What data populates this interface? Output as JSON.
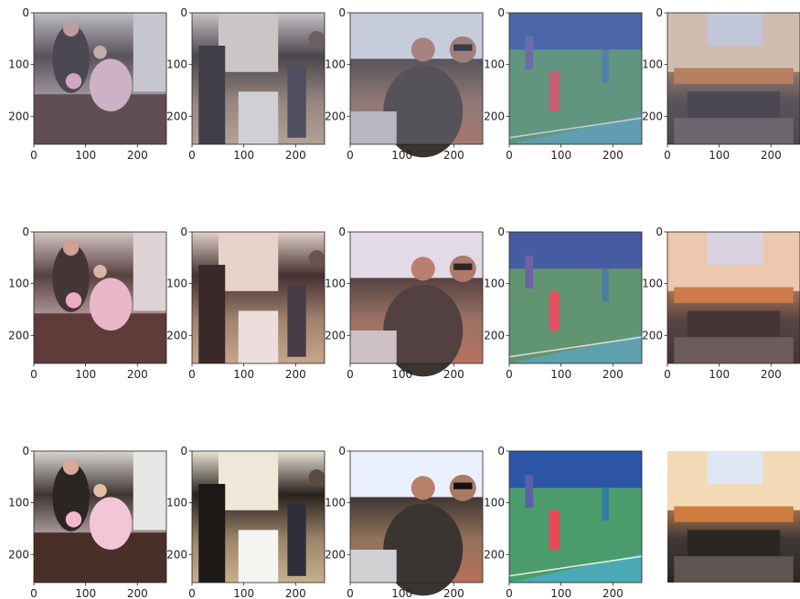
{
  "chart_data": {
    "type": "image-grid",
    "rows": 3,
    "cols": 5,
    "row_styles": [
      {
        "tint": "#8a8aa6",
        "opacity": 0.35,
        "desaturate": true
      },
      {
        "tint": "#c07a8a",
        "opacity": 0.18,
        "desaturate": false
      },
      {
        "tint": "#ffffff",
        "opacity": 0.0,
        "desaturate": false
      }
    ],
    "panels": [
      {
        "id": "family-table",
        "scene": "two people at a table with flowers",
        "base": [
          "#d9d5d2",
          "#3f3531",
          "#b8a7a9",
          "#4a342c"
        ],
        "accent": "#f1c6d7",
        "has_axes": true
      },
      {
        "id": "kitchen",
        "scene": "kitchen with two people",
        "base": [
          "#e8e2d6",
          "#29211d",
          "#9b846a",
          "#c8b08c"
        ],
        "accent": "#f1efe9",
        "has_axes": true
      },
      {
        "id": "group",
        "scene": "group of men with sunglasses",
        "base": [
          "#eef3fb",
          "#3a3331",
          "#93715b",
          "#b86f57"
        ],
        "accent": "#f0c36b",
        "has_axes": true
      },
      {
        "id": "tennis",
        "scene": "tennis court",
        "base": [
          "#2f59a7",
          "#3f8f63",
          "#46a3a6",
          "#9ac9a3"
        ],
        "accent": "#e64a5a",
        "has_axes": true
      },
      {
        "id": "computer-desk",
        "scene": "computer desk and keyboard",
        "base": [
          "#f3d7b0",
          "#d58d50",
          "#403936",
          "#2b2623"
        ],
        "accent": "#dfe7f5",
        "has_axes": true
      }
    ],
    "last_panel_axes_hidden_rows": [
      2
    ],
    "x_ticks": [
      0,
      100,
      200
    ],
    "y_ticks": [
      0,
      100,
      200
    ],
    "xlim": [
      0,
      256
    ],
    "ylim": [
      256,
      0
    ]
  }
}
